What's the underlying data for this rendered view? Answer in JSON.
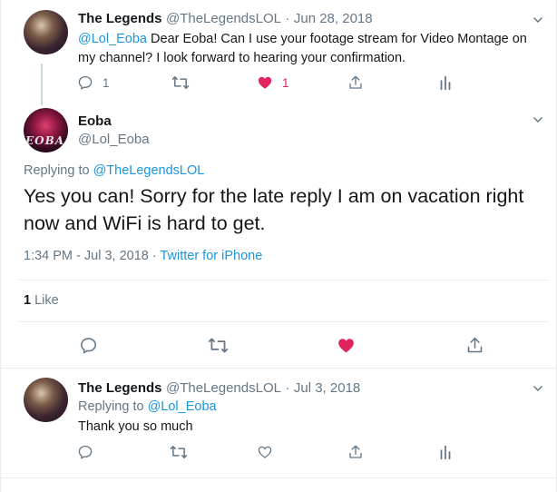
{
  "parent_tweet": {
    "name": "The Legends",
    "handle": "@TheLegendsLOL",
    "date": "Jun 28, 2018",
    "mention": "@Lol_Eoba",
    "text": " Dear Eoba! Can I use your footage stream for Video Montage on my channel? I look forward to hearing your confirmation.",
    "reply_count": "1",
    "like_count": "1"
  },
  "main_tweet": {
    "name": "Eoba",
    "handle": "@Lol_Eoba",
    "avatar_text": "EOBA",
    "replying_label": "Replying to ",
    "replying_to": "@TheLegendsLOL",
    "text": "Yes you can! Sorry for the late reply I am on vacation right now and WiFi is hard to get.",
    "time": "1:34 PM - Jul 3, 2018",
    "separator": " · ",
    "source": "Twitter for iPhone",
    "likes_count": "1",
    "likes_label": " Like"
  },
  "reply_tweet": {
    "name": "The Legends",
    "handle": "@TheLegendsLOL",
    "date": "Jul 3, 2018",
    "replying_label": "Replying to ",
    "replying_to": "@Lol_Eoba",
    "text": "Thank you so much"
  },
  "colors": {
    "accent": "#1b95e0",
    "like": "#e0245e",
    "muted": "#657786",
    "border": "#e6ecf0"
  },
  "icons": [
    "reply-icon",
    "retweet-icon",
    "like-icon",
    "share-icon",
    "analytics-icon",
    "chevron-down-icon"
  ]
}
